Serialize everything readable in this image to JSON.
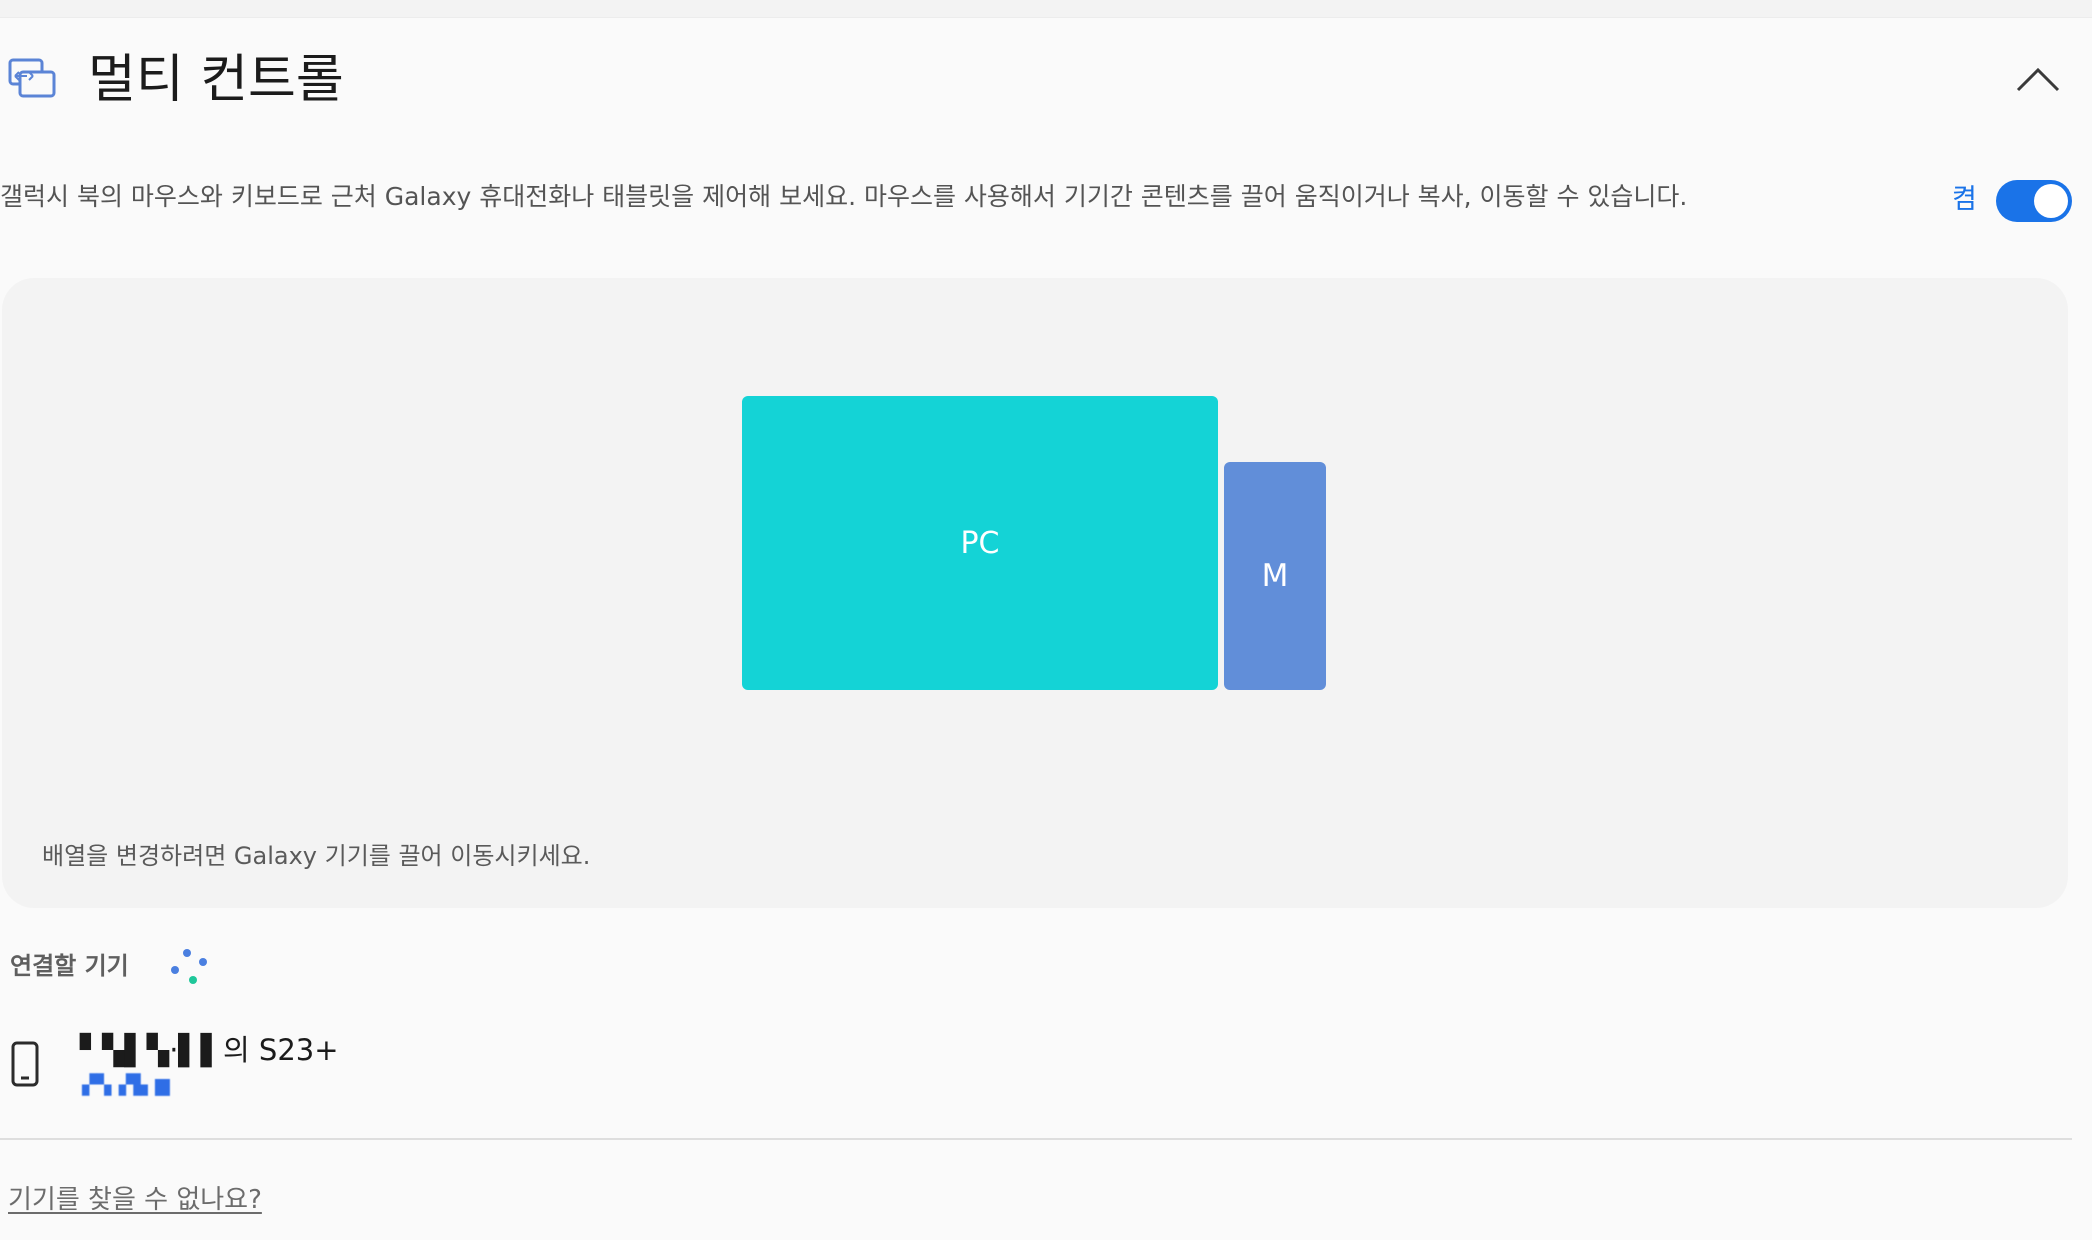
{
  "section": {
    "title": "멀티 컨트롤",
    "icon": "multi-control-icon",
    "collapse_icon": "chevron-up-icon"
  },
  "description": "갤럭시 북의 마우스와 키보드로 근처 Galaxy 휴대전화나 태블릿을 제어해 보세요. 마우스를 사용해서 기기간 콘텐츠를 끌어 움직이거나 복사, 이동할 수 있습니다.",
  "toggle": {
    "label": "켬",
    "on": true,
    "accent": "#1a73e8"
  },
  "arrangement": {
    "pc_label": "PC",
    "pc_color": "#14d3d6",
    "mobile_label": "M",
    "mobile_color": "#618ed9",
    "hint": "배열을 변경하려면 Galaxy 기기를 끌어 이동시키세요."
  },
  "devices": {
    "heading": "연결할 기기",
    "loading_icon": "loading-dots-icon",
    "items": [
      {
        "name": "▘▚▌▚·▌▌의 S23+",
        "status": "▞▚▗▜▖▆",
        "icon": "phone-icon"
      }
    ]
  },
  "help_link": "기기를 찾을 수 없나요?"
}
